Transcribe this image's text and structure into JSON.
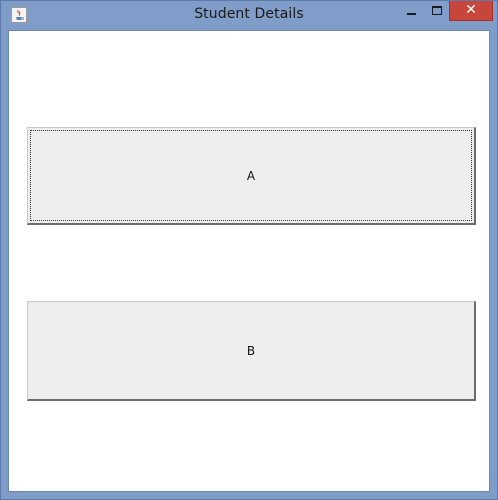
{
  "window": {
    "title": "Student Details",
    "icon": "java-cup-icon",
    "controls": {
      "minimize": "minimize-icon",
      "maximize": "maximize-icon",
      "close_label": "✕"
    }
  },
  "buttons": [
    {
      "label": "A",
      "focused": true
    },
    {
      "label": "B",
      "focused": false
    }
  ],
  "colors": {
    "frame": "#809cc8",
    "close_button": "#c7463c",
    "button_face": "#eeeeee",
    "client_background": "#ffffff"
  }
}
